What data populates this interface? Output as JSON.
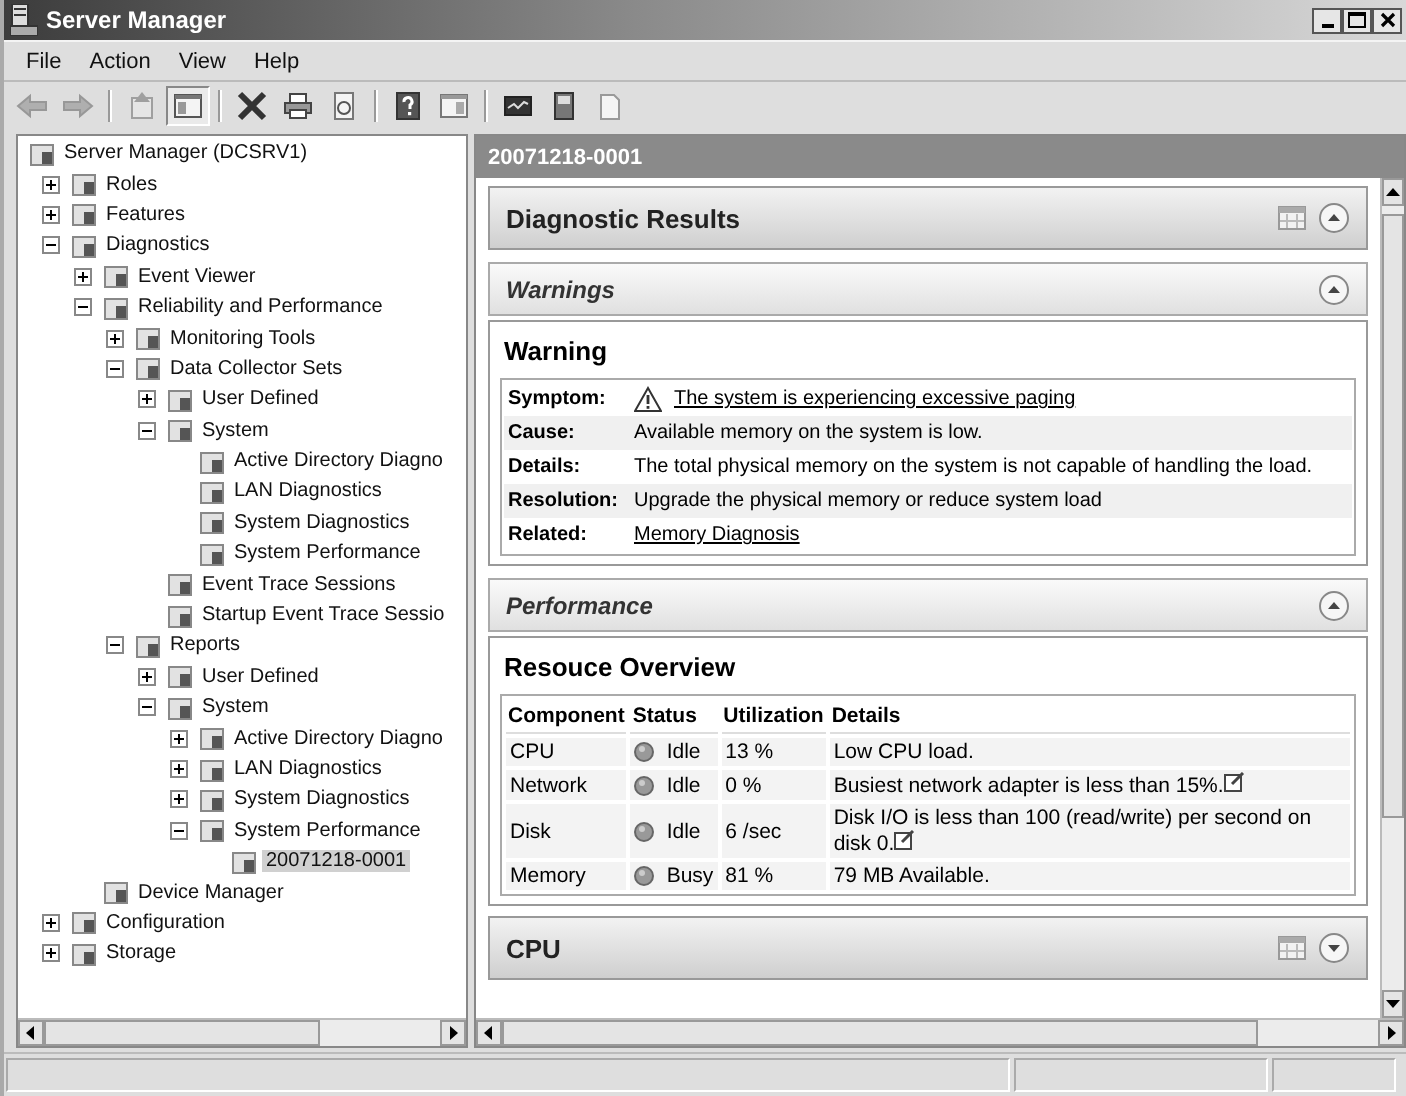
{
  "window": {
    "title": "Server Manager"
  },
  "menu": [
    "File",
    "Action",
    "View",
    "Help"
  ],
  "toolbar": [
    {
      "kind": "back",
      "disabled": true,
      "pressed": false
    },
    {
      "kind": "forward",
      "disabled": true,
      "pressed": false
    },
    {
      "kind": "separator"
    },
    {
      "kind": "up",
      "disabled": true,
      "pressed": false
    },
    {
      "kind": "tree",
      "disabled": false,
      "pressed": true
    },
    {
      "kind": "separator"
    },
    {
      "kind": "delete",
      "disabled": false,
      "pressed": false
    },
    {
      "kind": "print",
      "disabled": false,
      "pressed": false
    },
    {
      "kind": "refresh",
      "disabled": false,
      "pressed": false
    },
    {
      "kind": "separator"
    },
    {
      "kind": "help",
      "disabled": false,
      "pressed": false
    },
    {
      "kind": "action-pane",
      "disabled": false,
      "pressed": false
    },
    {
      "kind": "separator"
    },
    {
      "kind": "monitor",
      "disabled": false,
      "pressed": false
    },
    {
      "kind": "book",
      "disabled": false,
      "pressed": false
    },
    {
      "kind": "page",
      "disabled": false,
      "pressed": false
    }
  ],
  "tree": [
    {
      "label": "Server Manager (DCSRV1)",
      "selected": false,
      "children": [
        {
          "label": "Roles",
          "expanded": false,
          "selected": false
        },
        {
          "label": "Features",
          "expanded": false,
          "selected": false
        },
        {
          "label": "Diagnostics",
          "expanded": true,
          "selected": false,
          "children": [
            {
              "label": "Event Viewer",
              "expanded": false,
              "selected": false
            },
            {
              "label": "Reliability and Performance",
              "expanded": true,
              "selected": false,
              "children": [
                {
                  "label": "Monitoring Tools",
                  "expanded": false,
                  "selected": false
                },
                {
                  "label": "Data Collector Sets",
                  "expanded": true,
                  "selected": false,
                  "children": [
                    {
                      "label": "User Defined",
                      "expanded": false,
                      "selected": false
                    },
                    {
                      "label": "System",
                      "expanded": true,
                      "selected": false,
                      "children": [
                        {
                          "label": "Active Directory Diagno",
                          "selected": false
                        },
                        {
                          "label": "LAN Diagnostics",
                          "selected": false
                        },
                        {
                          "label": "System Diagnostics",
                          "selected": false
                        },
                        {
                          "label": "System Performance",
                          "selected": false
                        }
                      ]
                    },
                    {
                      "label": "Event Trace Sessions",
                      "selected": false
                    },
                    {
                      "label": "Startup Event Trace Sessio",
                      "selected": false
                    }
                  ]
                },
                {
                  "label": "Reports",
                  "expanded": true,
                  "selected": false,
                  "children": [
                    {
                      "label": "User Defined",
                      "expanded": false,
                      "selected": false
                    },
                    {
                      "label": "System",
                      "expanded": true,
                      "selected": false,
                      "children": [
                        {
                          "label": "Active Directory Diagno",
                          "expanded": false,
                          "selected": false
                        },
                        {
                          "label": "LAN Diagnostics",
                          "expanded": false,
                          "selected": false
                        },
                        {
                          "label": "System Diagnostics",
                          "expanded": false,
                          "selected": false
                        },
                        {
                          "label": "System Performance",
                          "expanded": true,
                          "selected": false,
                          "children": [
                            {
                              "label": "20071218-0001",
                              "selected": true
                            }
                          ]
                        }
                      ]
                    }
                  ]
                }
              ]
            },
            {
              "label": "Device Manager",
              "selected": false
            }
          ]
        },
        {
          "label": "Configuration",
          "expanded": false,
          "selected": false
        },
        {
          "label": "Storage",
          "expanded": false,
          "selected": false
        }
      ]
    }
  ],
  "content": {
    "header": "20071218-0001",
    "sections": [
      {
        "kind": "group",
        "title": "Diagnostic Results",
        "expanded": true
      },
      {
        "kind": "subgroup",
        "title": "Warnings",
        "expanded": true
      },
      {
        "kind": "warning",
        "title": "Warning",
        "rows": [
          {
            "label": "Symptom:",
            "value": "The system is experiencing excessive paging",
            "kind": "alert-link"
          },
          {
            "label": "Cause:",
            "value": "Available memory on the system is low.",
            "kind": "text"
          },
          {
            "label": "Details:",
            "value": "The total physical memory on the system is not capable of handling the load.",
            "kind": "text"
          },
          {
            "label": "Resolution:",
            "value": "Upgrade the physical memory or reduce system load",
            "kind": "text"
          },
          {
            "label": "Related:",
            "value": "Memory Diagnosis",
            "kind": "link"
          }
        ]
      },
      {
        "kind": "subgroup",
        "title": "Performance",
        "expanded": true
      },
      {
        "kind": "resources",
        "title": "Resouce Overview",
        "columns": [
          "Component",
          "Status",
          "Utilization",
          "Details"
        ],
        "rows": [
          {
            "component": "CPU",
            "status": "Idle",
            "utilization": "13 %",
            "details": "Low CPU load.",
            "has_note": false
          },
          {
            "component": "Network",
            "status": "Idle",
            "utilization": "0 %",
            "details": "Busiest network adapter is less than 15%.",
            "has_note": true
          },
          {
            "component": "Disk",
            "status": "Idle",
            "utilization": "6 /sec",
            "details": "Disk I/O is less than 100 (read/write) per second on disk 0.",
            "has_note": true
          },
          {
            "component": "Memory",
            "status": "Busy",
            "utilization": "81 %",
            "details": "79 MB Available.",
            "has_note": false
          }
        ]
      },
      {
        "kind": "group",
        "title": "CPU",
        "expanded": false
      }
    ]
  }
}
